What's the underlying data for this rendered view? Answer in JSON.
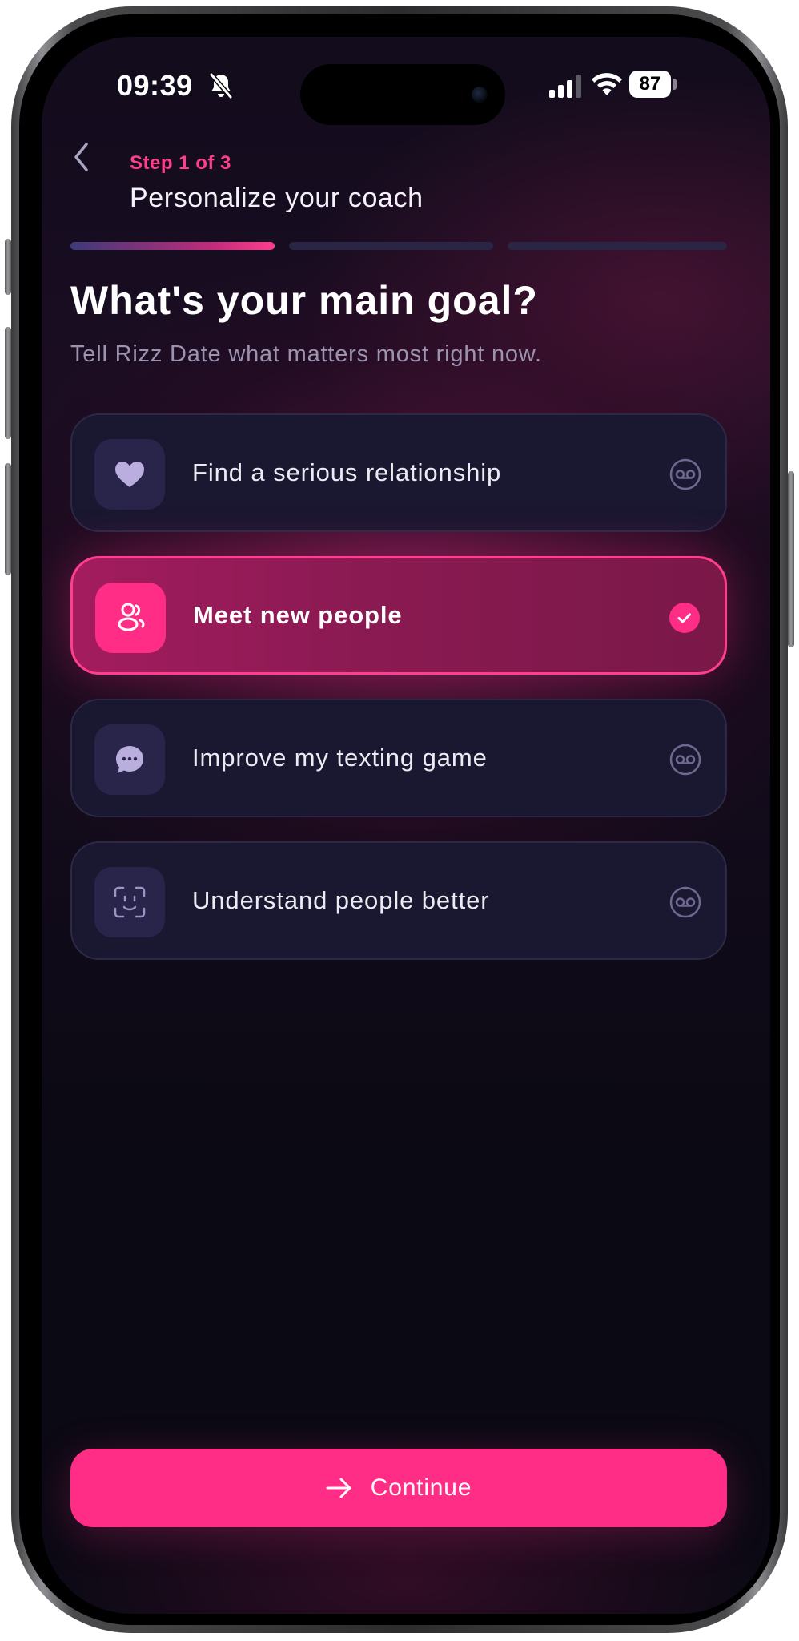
{
  "status_bar": {
    "time": "09:39",
    "battery": "87",
    "icons": [
      "bell-slash-icon",
      "signal-icon",
      "wifi-icon",
      "battery-icon"
    ]
  },
  "header": {
    "step": "Step 1 of 3",
    "title": "Personalize your coach",
    "back_icon": "chevron-left-icon"
  },
  "progress": {
    "total_steps": 3,
    "current_step": 1
  },
  "question": {
    "title": "What's your main goal?",
    "subtitle": "Tell Rizz Date what matters most right now."
  },
  "options": [
    {
      "label": "Find a serious relationship",
      "icon": "heart-icon",
      "selected": false
    },
    {
      "label": "Meet new people",
      "icon": "people-icon",
      "selected": true
    },
    {
      "label": "Improve my texting game",
      "icon": "chat-bubble-icon",
      "selected": false
    },
    {
      "label": "Understand people better",
      "icon": "face-scan-icon",
      "selected": false
    }
  ],
  "continue_button": {
    "label": "Continue",
    "icon": "arrow-right-icon"
  },
  "colors": {
    "accent": "#ff2d86",
    "accent_text": "#ff3e8f",
    "background": "#0b0914",
    "card": "#1a1730",
    "icon_box": "#29244a"
  }
}
